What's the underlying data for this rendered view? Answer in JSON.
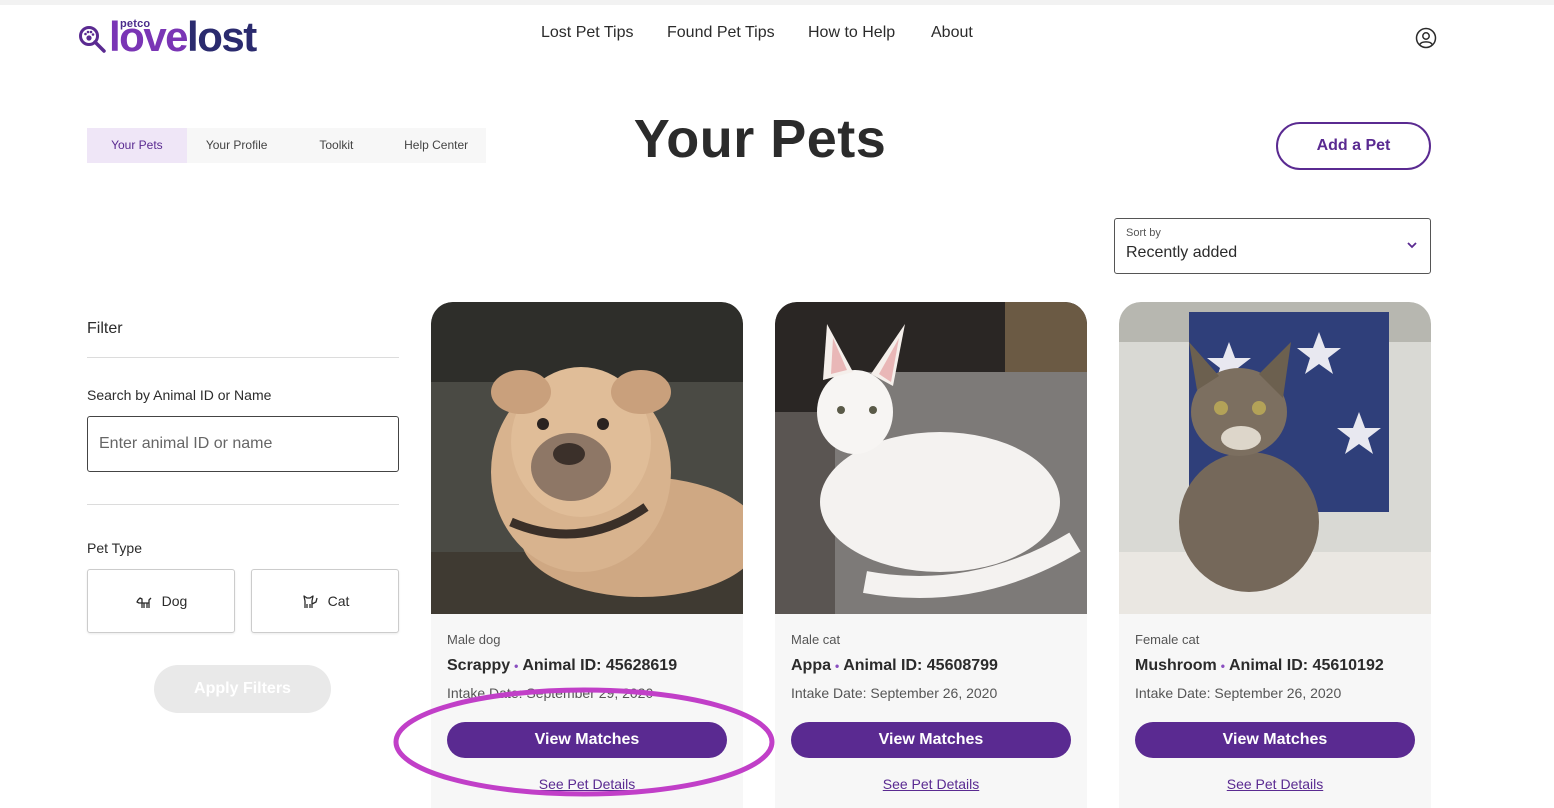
{
  "brand": {
    "petco": "petco",
    "love": "love",
    "lost": "lost"
  },
  "nav": [
    {
      "label": "Lost Pet Tips"
    },
    {
      "label": "Found Pet Tips"
    },
    {
      "label": "How to Help"
    },
    {
      "label": "About"
    }
  ],
  "tabs": [
    {
      "label": "Your Pets",
      "active": true
    },
    {
      "label": "Your Profile"
    },
    {
      "label": "Toolkit"
    },
    {
      "label": "Help Center"
    }
  ],
  "page_title": "Your Pets",
  "add_pet_label": "Add a Pet",
  "sort": {
    "label": "Sort by",
    "value": "Recently added"
  },
  "filter": {
    "title": "Filter",
    "search_label": "Search by Animal ID or Name",
    "search_placeholder": "Enter animal ID or name",
    "search_value": "",
    "pet_type_label": "Pet Type",
    "types": [
      {
        "label": "Dog",
        "icon": "dog-icon"
      },
      {
        "label": "Cat",
        "icon": "cat-icon"
      }
    ],
    "apply_label": "Apply Filters"
  },
  "pets": [
    {
      "type": "Male dog",
      "name": "Scrappy",
      "separator": "•",
      "animal_id": "Animal ID: 45628619",
      "intake": "Intake Date: September 29, 2020",
      "match_label": "View Matches",
      "details_label": "See Pet Details"
    },
    {
      "type": "Male cat",
      "name": "Appa",
      "separator": "•",
      "animal_id": "Animal ID: 45608799",
      "intake": "Intake Date: September 26, 2020",
      "match_label": "View Matches",
      "details_label": "See Pet Details"
    },
    {
      "type": "Female cat",
      "name": "Mushroom",
      "separator": "•",
      "animal_id": "Animal ID: 45610192",
      "intake": "Intake Date: September 26, 2020",
      "match_label": "View Matches",
      "details_label": "See Pet Details"
    }
  ],
  "colors": {
    "brand_purple": "#5a2a91",
    "highlight_ring": "#c13fc8"
  }
}
